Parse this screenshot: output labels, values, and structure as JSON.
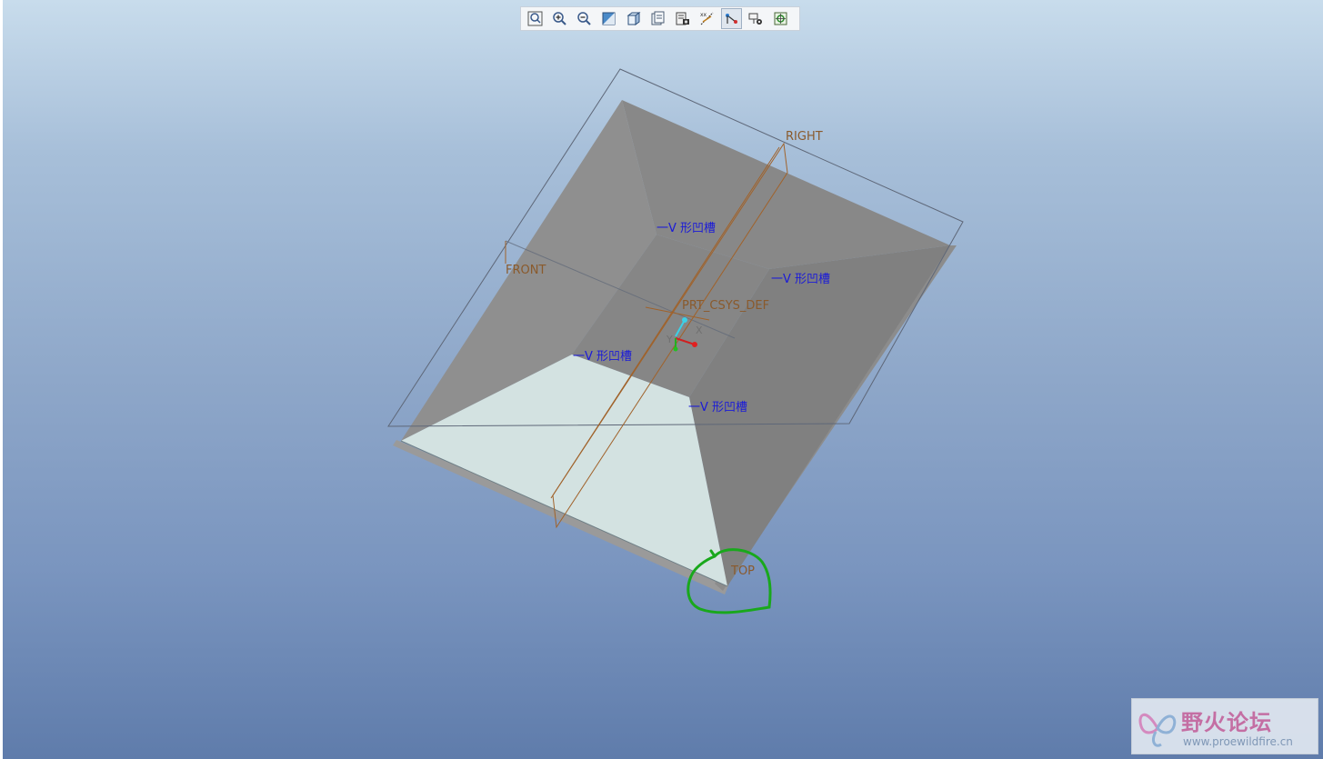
{
  "toolbar": {
    "buttons": [
      {
        "icon": "zoom-fit-icon"
      },
      {
        "icon": "zoom-in-icon"
      },
      {
        "icon": "zoom-out-icon"
      },
      {
        "icon": "repaint-icon"
      },
      {
        "icon": "display-style-icon"
      },
      {
        "icon": "saved-views-icon"
      },
      {
        "icon": "layers-icon"
      },
      {
        "icon": "datum-display-icon"
      },
      {
        "icon": "csys-display-icon",
        "active": true
      },
      {
        "icon": "annotation-display-icon"
      },
      {
        "icon": "spin-center-icon"
      }
    ]
  },
  "datums": {
    "right": "RIGHT",
    "front": "FRONT",
    "top": "TOP",
    "csys": "PRT_CSYS_DEF",
    "axis_x": "X",
    "axis_y": "Y"
  },
  "features": {
    "groove_1": "一V 形凹槽",
    "groove_2": "一V 形凹槽",
    "groove_3": "一V 形凹槽",
    "groove_4": "一V 形凹槽"
  },
  "watermark": {
    "title": "野火论坛",
    "url": "www.proewildfire.cn"
  },
  "colors": {
    "face_light": "#d3e2e1",
    "face_mid": "#8f8f8f",
    "face_dark": "#808080",
    "datum_line": "#a0622a",
    "feature_label": "#1a1ad8",
    "highlight_circle": "#1aa81a"
  }
}
